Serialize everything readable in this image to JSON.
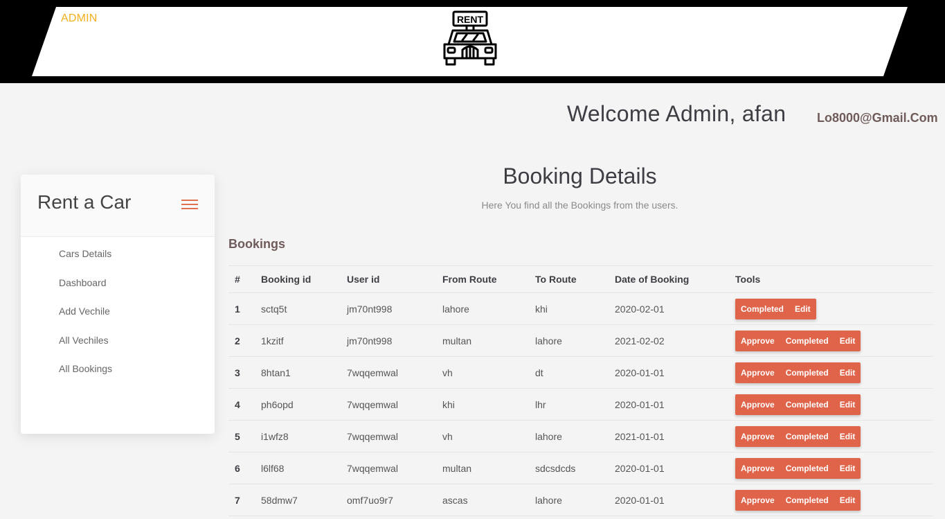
{
  "header": {
    "admin_label": "ADMIN",
    "logo_text": "RENT"
  },
  "user": {
    "welcome": "Welcome Admin, afan",
    "email": "Lo8000@Gmail.Com"
  },
  "sidebar": {
    "brand": "Rent a Car",
    "items": [
      {
        "label": "Cars Details"
      },
      {
        "label": "Dashboard"
      },
      {
        "label": "Add Vechile"
      },
      {
        "label": "All Vechiles"
      },
      {
        "label": "All Bookings"
      }
    ]
  },
  "main": {
    "title": "Booking Details",
    "subtitle": "Here You find all the Bookings from the users.",
    "table_title": "Bookings",
    "columns": [
      "#",
      "Booking id",
      "User id",
      "From Route",
      "To Route",
      "Date of Booking",
      "Tools"
    ],
    "rows": [
      {
        "num": "1",
        "booking_id": "sctq5t",
        "user_id": "jm70nt998",
        "from": "lahore",
        "to": "khi",
        "date": "2020-02-01",
        "tools": [
          "Completed",
          "Edit"
        ]
      },
      {
        "num": "2",
        "booking_id": "1kzitf",
        "user_id": "jm70nt998",
        "from": "multan",
        "to": "lahore",
        "date": "2021-02-02",
        "tools": [
          "Approve",
          "Completed",
          "Edit"
        ]
      },
      {
        "num": "3",
        "booking_id": "8htan1",
        "user_id": "7wqqemwal",
        "from": "vh",
        "to": "dt",
        "date": "2020-01-01",
        "tools": [
          "Approve",
          "Completed",
          "Edit"
        ]
      },
      {
        "num": "4",
        "booking_id": "ph6opd",
        "user_id": "7wqqemwal",
        "from": "khi",
        "to": "lhr",
        "date": "2020-01-01",
        "tools": [
          "Approve",
          "Completed",
          "Edit"
        ]
      },
      {
        "num": "5",
        "booking_id": "i1wfz8",
        "user_id": "7wqqemwal",
        "from": "vh",
        "to": "lahore",
        "date": "2021-01-01",
        "tools": [
          "Approve",
          "Completed",
          "Edit"
        ]
      },
      {
        "num": "6",
        "booking_id": "l6lf68",
        "user_id": "7wqqemwal",
        "from": "multan",
        "to": "sdcsdcds",
        "date": "2020-01-01",
        "tools": [
          "Approve",
          "Completed",
          "Edit"
        ]
      },
      {
        "num": "7",
        "booking_id": "58dmw7",
        "user_id": "omf7uo9r7",
        "from": "ascas",
        "to": "lahore",
        "date": "2020-01-01",
        "tools": [
          "Approve",
          "Completed",
          "Edit"
        ]
      }
    ]
  },
  "colors": {
    "accent": "#e0644a",
    "admin_label": "#f2b01e",
    "topbar": "#000000"
  }
}
